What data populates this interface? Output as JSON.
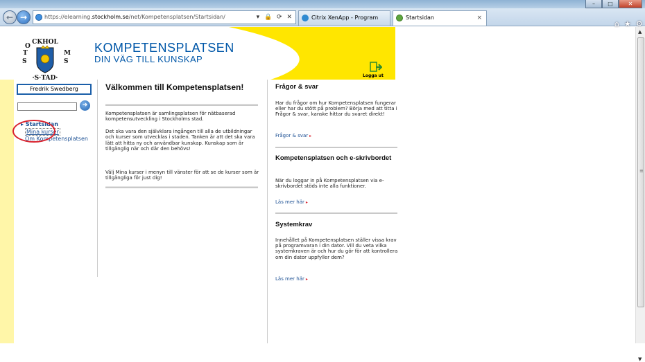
{
  "browser": {
    "address_prefix": "https://elearning.",
    "address_host": "stockholm.se",
    "address_path": "/net/Kompetensplatsen/Startsidan/",
    "address_controls": "▾ 🔒 ⟳ ✕",
    "tabs": [
      {
        "label": "Citrix XenApp - Program"
      },
      {
        "label": "Startsidan",
        "close": "×"
      }
    ],
    "toolbar_icons": "⌂★⚙",
    "window_buttons": {
      "minimize": "–",
      "maximize": "□",
      "close": "✕"
    }
  },
  "header": {
    "title": "KOMPETENSPLATSEN",
    "subtitle": "DIN VÄG TILL KUNSKAP",
    "logout_label": "Logga ut",
    "accent_color": "#ffe600",
    "brand_color": "#0057a8"
  },
  "sidebar": {
    "user_name": "Fredrik Swedberg",
    "search_button": "➜",
    "menu": [
      {
        "label": "Startsidan",
        "prefix": "▸ "
      },
      {
        "label": "Mina kurser"
      },
      {
        "label": "Om Kompetensplatsen"
      }
    ]
  },
  "main": {
    "title": "Välkommen till Kompetensplatsen!",
    "paragraphs": [
      "Kompetensplatsen är samlingsplatsen för nätbaserad kompetensutveckling i Stockholms stad.",
      "Det ska vara den självklara ingången till alla de utbildningar och kurser som utvecklas i staden. Tanken är att det ska vara lätt att hitta ny och användbar kunskap. Kunskap som är tillgänglig när och där den behövs!",
      "Välj Mina kurser i menyn till vänster för att se de kurser som är tillgängliga för just dig!"
    ]
  },
  "right": {
    "sections": [
      {
        "title": "Frågor & svar",
        "text": "Har du frågor om hur Kompetensplatsen fungerar eller har du stött på problem? Börja med att titta i Frågor & svar, kanske hittar du svaret direkt!",
        "link": "Frågor & svar"
      },
      {
        "title": "Kompetensplatsen och e-skrivbordet",
        "text": "När du loggar in på Kompetensplatsen via e-skrivbordet stöds inte alla funktioner.",
        "link": "Läs mer här"
      },
      {
        "title": "Systemkrav",
        "text": "Innehållet på Kompetensplatsen ställer vissa krav på programvaran i din dator. Vill du veta vilka systemkraven är och hur du gör för att kontrollera om din dator uppfyller dem?",
        "link": "Läs mer här"
      }
    ],
    "link_arrow": "▸"
  }
}
